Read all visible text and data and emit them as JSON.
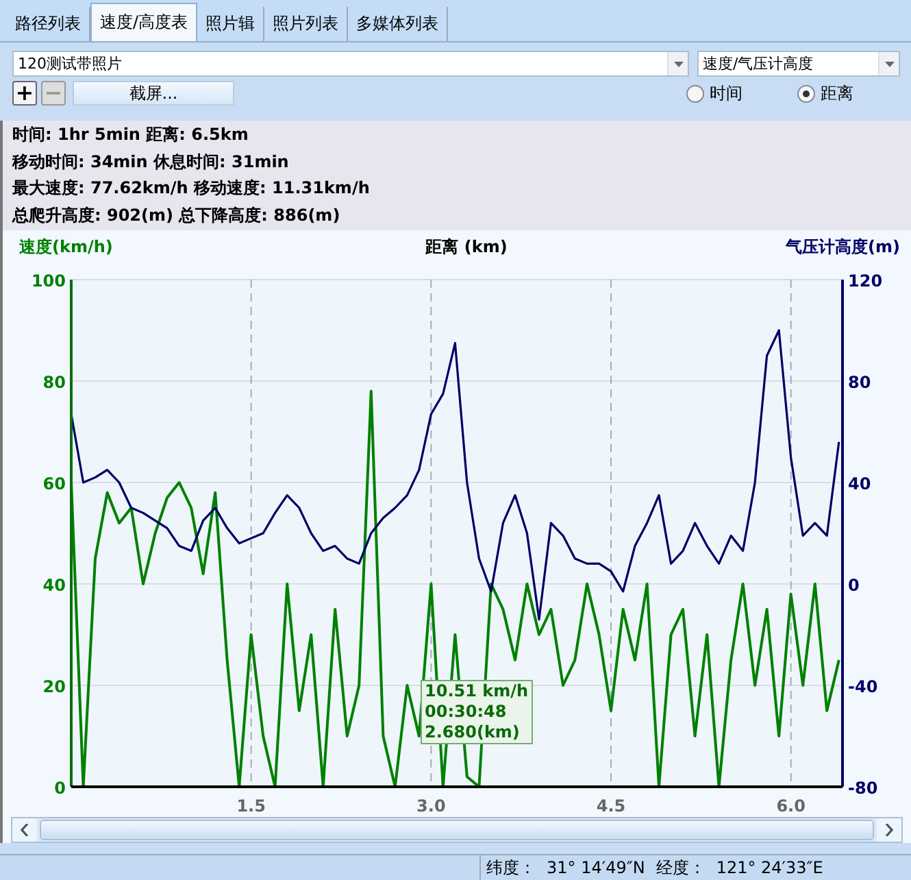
{
  "tabs": [
    {
      "label": "路径列表",
      "selected": false
    },
    {
      "label": "速度/高度表",
      "selected": true
    },
    {
      "label": "照片辑",
      "selected": false
    },
    {
      "label": "照片列表",
      "selected": false
    },
    {
      "label": "多媒体列表",
      "selected": false
    }
  ],
  "track_select": {
    "value": "120测试带照片"
  },
  "chart_select": {
    "value": "速度/气压计高度"
  },
  "toolbar": {
    "zoom_in": "+",
    "zoom_out": "−",
    "screenshot_button": "截屏..."
  },
  "axis_mode": [
    {
      "label": "时间",
      "selected": false
    },
    {
      "label": "距离",
      "selected": true
    }
  ],
  "stats": [
    "时间: 1hr 5min  距离: 6.5km",
    "移动时间: 34min  休息时间: 31min",
    "最大速度: 77.62km/h  移动速度: 11.31km/h",
    "总爬升高度: 902(m)  总下降高度: 886(m)"
  ],
  "chart": {
    "chart_data": {
      "type": "line",
      "xlabel": "距离 (km)",
      "ylabel": "速度(km/h)",
      "y2label": "气压计高度(m)",
      "xlim": [
        0,
        6.43
      ],
      "ylim": [
        0,
        100
      ],
      "y2lim": [
        -80,
        120
      ],
      "xticks": [
        1.5,
        {
          "value": 3,
          "label": "3.0"
        },
        4.5,
        {
          "value": 6,
          "label": "6.0"
        }
      ],
      "grid": true,
      "yticks": [
        0,
        20,
        40,
        60,
        80,
        100
      ],
      "y2ticks": [
        -80,
        -40,
        0,
        40,
        80,
        120
      ],
      "x": [
        0,
        0.1,
        0.2,
        0.3,
        0.4,
        0.5,
        0.6,
        0.7,
        0.8,
        0.9,
        1.0,
        1.1,
        1.2,
        1.3,
        1.4,
        1.5,
        1.6,
        1.7,
        1.8,
        1.9,
        2.0,
        2.1,
        2.2,
        2.3,
        2.4,
        2.5,
        2.6,
        2.7,
        2.8,
        2.9,
        3.0,
        3.1,
        3.2,
        3.3,
        3.4,
        3.5,
        3.6,
        3.7,
        3.8,
        3.9,
        4.0,
        4.1,
        4.2,
        4.3,
        4.4,
        4.5,
        4.6,
        4.7,
        4.8,
        4.9,
        5.0,
        5.1,
        5.2,
        5.3,
        5.4,
        5.5,
        5.6,
        5.7,
        5.8,
        5.9,
        6.0,
        6.1,
        6.2,
        6.3,
        6.4
      ],
      "series": [
        {
          "color": "#008000",
          "axis": "y",
          "values": [
            60,
            0,
            45,
            58,
            52,
            55,
            40,
            50,
            57,
            60,
            55,
            42,
            58,
            25,
            0,
            30,
            10,
            0,
            40,
            15,
            30,
            0,
            35,
            10,
            20,
            78,
            10,
            0,
            20,
            10,
            40,
            0,
            30,
            2,
            0,
            40,
            35,
            25,
            40,
            30,
            35,
            20,
            25,
            40,
            30,
            15,
            35,
            25,
            40,
            0,
            30,
            35,
            10,
            30,
            0,
            25,
            40,
            20,
            35,
            10,
            38,
            20,
            40,
            15,
            25
          ]
        },
        {
          "color": "#000066",
          "axis": "y2",
          "values": [
            67,
            40,
            42,
            45,
            40,
            30,
            28,
            25,
            22,
            15,
            13,
            25,
            30,
            22,
            16,
            18,
            20,
            28,
            35,
            30,
            20,
            13,
            15,
            10,
            8,
            20,
            26,
            30,
            35,
            45,
            67,
            75,
            95,
            40,
            10,
            -3,
            24,
            35,
            20,
            -14,
            24,
            19,
            10,
            8,
            8,
            5,
            -3,
            15,
            24,
            35,
            8,
            13,
            24,
            15,
            8,
            19,
            13,
            40,
            90,
            100,
            50,
            19,
            24,
            19,
            56
          ]
        }
      ]
    },
    "tooltip": [
      "10.51 km/h",
      "00:30:48",
      "2.680(km)"
    ]
  },
  "status_bar": {
    "latitude_label": "纬度：",
    "latitude": "31° 14′49″N",
    "longitude_label": "经度：",
    "longitude": "121° 24′33″E"
  }
}
